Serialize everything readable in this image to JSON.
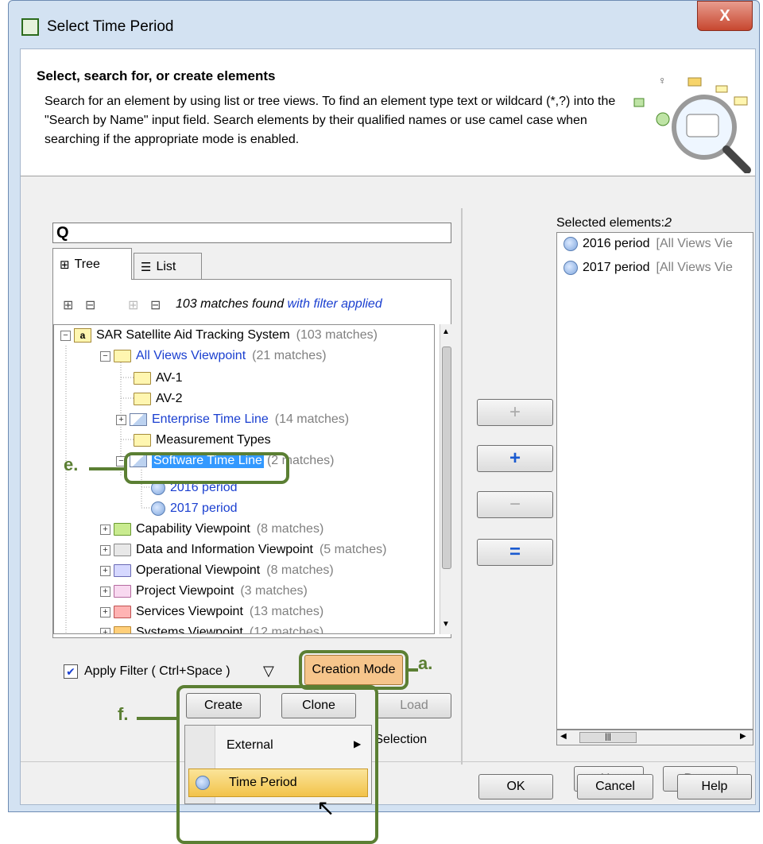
{
  "window": {
    "title": "Select Time Period",
    "close_label": "X"
  },
  "header": {
    "title": "Select, search for, or create elements",
    "description": "Search for an element by using list or tree views. To find an element type text or wildcard (*,?) into the \"Search by Name\" input field. Search elements by their qualified names or use camel case when searching if the appropriate mode is enabled."
  },
  "search": {
    "icon": "Q",
    "value": ""
  },
  "tabs": {
    "tree": "Tree",
    "list": "List"
  },
  "toolbar": {
    "matches_text": "103 matches found",
    "filter_text": "with filter applied"
  },
  "tree": {
    "root": {
      "label": "SAR Satellite Aid Tracking System",
      "count": "(103 matches)"
    },
    "all_views": {
      "label": "All Views Viewpoint",
      "count": "(21 matches)"
    },
    "av1": "AV-1",
    "av2": "AV-2",
    "enterprise": {
      "label": "Enterprise Time Line",
      "count": "(14 matches)"
    },
    "measurement": "Measurement Types",
    "software": {
      "label": "Software Time Line",
      "count": "(2 matches)"
    },
    "p2016": "2016 period",
    "p2017": "2017 period",
    "capability": {
      "label": "Capability Viewpoint",
      "count": "(8 matches)"
    },
    "data_info": {
      "label": "Data and Information Viewpoint",
      "count": "(5 matches)"
    },
    "operational": {
      "label": "Operational Viewpoint",
      "count": "(8 matches)"
    },
    "project": {
      "label": "Project Viewpoint",
      "count": "(3 matches)"
    },
    "services": {
      "label": "Services Viewpoint",
      "count": "(13 matches)"
    },
    "systems": {
      "label": "Systems Viewpoint",
      "count": "(12 matches)"
    }
  },
  "filter": {
    "apply_label": "Apply Filter ( Ctrl+Space )",
    "checked": true,
    "creation_mode": "Creation Mode"
  },
  "buttons": {
    "create": "Create",
    "clone": "Clone",
    "load": "Load",
    "single_selection": "e Selection",
    "up": "Up",
    "down": "Down",
    "ok": "OK",
    "cancel": "Cancel",
    "help": "Help",
    "add": "+",
    "add_recursive": "+",
    "remove": "−",
    "remove_all": "="
  },
  "menu": {
    "external": "External",
    "time_period": "Time Period"
  },
  "selected": {
    "label": "Selected elements:",
    "count": "2",
    "items": [
      {
        "name": "2016 period",
        "path": "[All Views Vie"
      },
      {
        "name": "2017 period",
        "path": "[All Views Vie"
      }
    ]
  },
  "callouts": {
    "a": "a.",
    "e": "e.",
    "f": "f."
  },
  "colors": {
    "accent_green": "#5b7f33",
    "link_blue": "#1a3fd0",
    "creation_orange": "#f6c58b"
  }
}
